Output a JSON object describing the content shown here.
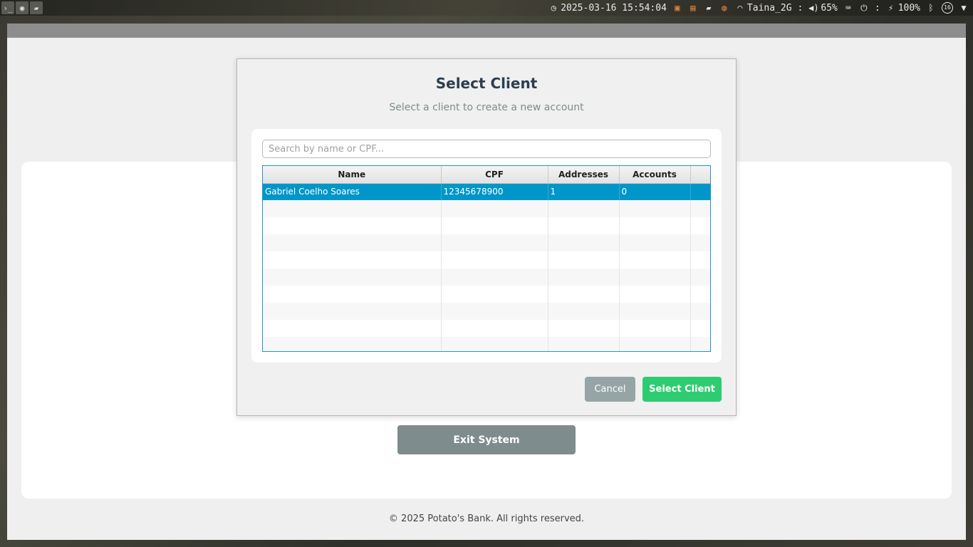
{
  "system_bar": {
    "datetime": "2025-03-16 15:54:04",
    "wifi_name": "Taina_2G",
    "separator": ":",
    "volume": "65%",
    "battery": "100%",
    "notification_count": "16",
    "icons": [
      "terminal-icon",
      "settings-icon",
      "folder-icon",
      "clock-icon",
      "terminal-icon",
      "calendar-icon",
      "folder-icon",
      "ubuntu-icon",
      "wifi-icon",
      "volume-icon",
      "keyboard-icon",
      "power-icon",
      "plug-icon",
      "bluetooth-icon",
      "notifications-icon",
      "wifi-icon"
    ]
  },
  "app": {
    "exit_label": "Exit System",
    "footer": "© 2025 Potato's Bank. All rights reserved."
  },
  "dialog": {
    "title": "Select Client",
    "subtitle": "Select a client to create a new account",
    "search_placeholder": "Search by name or CPF...",
    "search_value": "",
    "columns": [
      "Name",
      "CPF",
      "Addresses",
      "Accounts"
    ],
    "rows": [
      {
        "name": "Gabriel Coelho Soares",
        "cpf": "12345678900",
        "addresses": "1",
        "accounts": "0",
        "selected": true
      }
    ],
    "cancel_label": "Cancel",
    "select_label": "Select Client"
  },
  "colors": {
    "accent_blue": "#0096c9",
    "select_green": "#2ecc71",
    "cancel_gray": "#95a5a6",
    "exit_gray": "#7f8c8d",
    "title_dark": "#2c3e50"
  }
}
